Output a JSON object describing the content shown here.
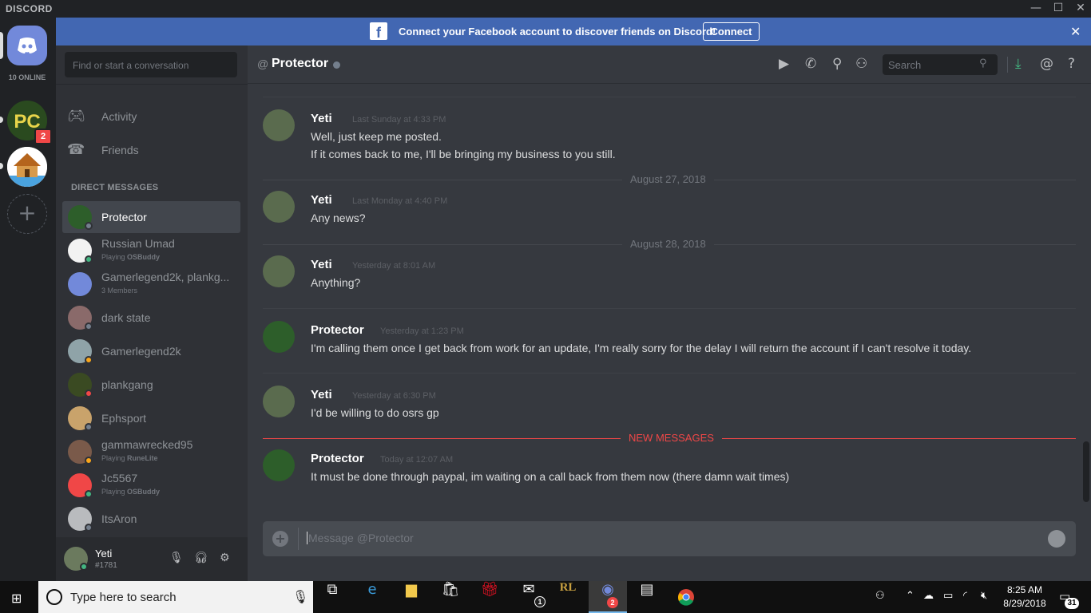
{
  "window": {
    "brand": "DISCORD"
  },
  "guilds": {
    "online": "10 ONLINE",
    "pc_badge": "2",
    "add": "+"
  },
  "banner": {
    "text": "Connect your Facebook account to discover friends on Discord!",
    "connect": "Connect",
    "fb": "f",
    "close": "✕"
  },
  "sidebar": {
    "search_placeholder": "Find or start a conversation",
    "nav": [
      {
        "label": "Activity",
        "icon": "gamepad-icon"
      },
      {
        "label": "Friends",
        "icon": "friends-icon"
      }
    ],
    "dm_header": "DIRECT MESSAGES",
    "dms": [
      {
        "name": "Protector",
        "sub_prefix": "",
        "sub_game": "",
        "status_color": "#747f8d",
        "avatar_color": "#2d5e2a",
        "selected": true
      },
      {
        "name": "Russian Umad",
        "sub_prefix": "Playing ",
        "sub_game": "OSBuddy",
        "status_color": "#43b581",
        "avatar_color": "#f2f2f2",
        "selected": false
      },
      {
        "name": "Gamerlegend2k, plankg...",
        "sub_prefix": "3 Members",
        "sub_game": "",
        "status_color": "",
        "avatar_color": "#7289da",
        "selected": false
      },
      {
        "name": "dark state",
        "sub_prefix": "",
        "sub_game": "",
        "status_color": "#747f8d",
        "avatar_color": "#8a6a6a",
        "selected": false
      },
      {
        "name": "Gamerlegend2k",
        "sub_prefix": "",
        "sub_game": "",
        "status_color": "#faa61a",
        "avatar_color": "#8fa3a8",
        "selected": false
      },
      {
        "name": "plankgang",
        "sub_prefix": "",
        "sub_game": "",
        "status_color": "#f04747",
        "avatar_color": "#3a4a22",
        "selected": false
      },
      {
        "name": "Ephsport",
        "sub_prefix": "",
        "sub_game": "",
        "status_color": "#747f8d",
        "avatar_color": "#c9a36b",
        "selected": false
      },
      {
        "name": "gammawrecked95",
        "sub_prefix": "Playing ",
        "sub_game": "RuneLite",
        "status_color": "#faa61a",
        "avatar_color": "#7a5a4a",
        "selected": false
      },
      {
        "name": "Jc5567",
        "sub_prefix": "Playing ",
        "sub_game": "OSBuddy",
        "status_color": "#43b581",
        "avatar_color": "#f04747",
        "selected": false
      },
      {
        "name": "ItsAron",
        "sub_prefix": "",
        "sub_game": "",
        "status_color": "#747f8d",
        "avatar_color": "#b9bbbe",
        "selected": false
      }
    ],
    "user": {
      "name": "Yeti",
      "tag": "#1781"
    }
  },
  "header": {
    "at": "@",
    "title": "Protector",
    "search_placeholder": "Search"
  },
  "messages": [
    {
      "author": "Yeti",
      "time": "Last Sunday at 4:33 PM",
      "lines": [
        "Well, just keep me posted.",
        "If it comes back to me, I'll be bringing my business to you still."
      ]
    },
    {
      "author": "Yeti",
      "time": "Last Monday at 4:40 PM",
      "lines": [
        "Any news?"
      ]
    },
    {
      "author": "Yeti",
      "time": "Yesterday at 8:01 AM",
      "lines": [
        "Anything?"
      ]
    },
    {
      "author": "Protector",
      "time": "Yesterday at 1:23 PM",
      "lines": [
        "I'm calling them once I get back from work for an update, I'm really sorry for the delay I will return the account if I can't resolve it today."
      ]
    },
    {
      "author": "Yeti",
      "time": "Yesterday at 6:30 PM",
      "lines": [
        "I'd be willing to do osrs gp"
      ]
    },
    {
      "author": "Protector",
      "time": "Today at 12:07 AM",
      "lines": [
        "It must be done through paypal, im waiting on a call back from them now (there damn wait times)"
      ]
    }
  ],
  "dividers": {
    "aug27": "August 27, 2018",
    "aug28": "August 28, 2018",
    "new": "NEW MESSAGES"
  },
  "composer": {
    "placeholder": "Message @Protector"
  },
  "taskbar": {
    "search": "Type here to search",
    "time": "8:25 AM",
    "date": "8/29/2018",
    "notifications": "31",
    "mail_badge": "1",
    "discord_badge": "2"
  },
  "colors": {
    "blurple": "#7289da",
    "facebook": "#4267b2",
    "new_messages": "#f04747"
  }
}
